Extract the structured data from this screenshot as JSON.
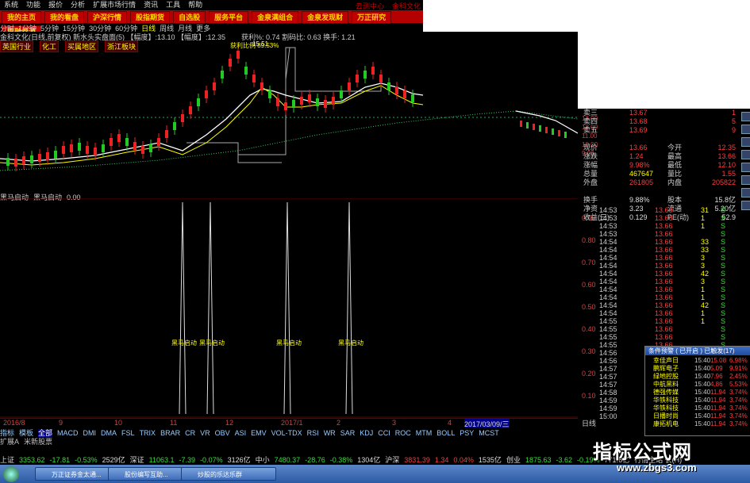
{
  "menu": [
    "系统",
    "功能",
    "报价",
    "分析",
    "扩展市场行情",
    "资讯",
    "工具",
    "帮助"
  ],
  "top_links": [
    "云测中心",
    "金科文化"
  ],
  "nav_tabs": [
    "我的主页",
    "我的看盘",
    "沪深行情",
    "股指期货",
    "自选股",
    "服务平台",
    "金泉满组合",
    "金泉发现财",
    "万正研究",
    "周融券源"
  ],
  "periods": [
    "分时",
    "1分钟",
    "5分钟",
    "15分钟",
    "30分钟",
    "60分钟",
    "日线",
    "周线",
    "月线",
    "更多"
  ],
  "info_line": "金科文化(日线,前复权) 新水头实盘面(5) 【幅度】:13.10 【幅度】:12.35",
  "info_right": "获利%: 0.74  割码比: 0.63  换手: 1.21",
  "tags": [
    "英国行业",
    "化工",
    "买属地区",
    "浙江板块"
  ],
  "chart_labels": {
    "max": "15.51",
    "profit": "获利比例 89.53%",
    "yellow_signals": [
      "金手指起",
      "金手指起",
      "金手指起"
    ]
  },
  "sub_indicator": {
    "name": "黑马启动",
    "field": "黑马启动",
    "value": "0.00"
  },
  "signal_label": "黑马启动",
  "signals_count": 4,
  "left_axis": [
    "0.90",
    "0.80",
    "0.70",
    "0.60",
    "0.50",
    "0.40",
    "0.30",
    "0.20",
    "0.10"
  ],
  "price_axis": [
    "13.00",
    "12.00",
    "11.00",
    "10.00",
    "9.00"
  ],
  "bottom_dates": [
    "2016/8",
    "9",
    "10",
    "11",
    "12",
    "2017/1",
    "2",
    "3",
    "4"
  ],
  "date_highlight": "2017/03/09/三",
  "indicator_tabs": [
    "指标",
    "模板",
    "全部",
    "MACD",
    "DMI",
    "DMA",
    "FSL",
    "TRIX",
    "BRAR",
    "CR",
    "VR",
    "OBV",
    "ASI",
    "EMV",
    "VOL-TDX",
    "RSI",
    "WR",
    "SAR",
    "KDJ",
    "CCI",
    "ROC",
    "MTM",
    "BOLL",
    "PSY",
    "MCST"
  ],
  "sheet_tabs": [
    "扩展A",
    "米新股票"
  ],
  "quote": {
    "rows": [
      {
        "l": "卖三",
        "m": "13.67",
        "mc": "up",
        "r": "",
        "rv": "1"
      },
      {
        "l": "卖四",
        "m": "13.68",
        "mc": "up",
        "r": "",
        "rv": "5"
      },
      {
        "l": "卖五",
        "m": "13.69",
        "mc": "up",
        "r": "",
        "rv": "9"
      },
      {
        "l": "",
        "m": "",
        "mc": "up",
        "r": "",
        "rv": ""
      },
      {
        "l": "现价",
        "m": "13.66",
        "mc": "up",
        "r": "今开",
        "rv": "12.35"
      },
      {
        "l": "涨跌",
        "m": "1.24",
        "mc": "up",
        "r": "最高",
        "rv": "13.66"
      },
      {
        "l": "涨幅",
        "m": "9.98%",
        "mc": "up",
        "r": "最低",
        "rv": "12.10"
      },
      {
        "l": "总量",
        "m": "467647",
        "mc": "yl",
        "r": "量比",
        "rv": "1.55"
      },
      {
        "l": "外盘",
        "m": "261805",
        "mc": "up",
        "r": "内盘",
        "rv": "205822"
      },
      {
        "l": "",
        "m": "",
        "mc": "up",
        "r": "",
        "rv": ""
      },
      {
        "l": "换手",
        "m": "9.88%",
        "mc": "wt",
        "r": "股本",
        "rv": "15.8亿"
      },
      {
        "l": "净资",
        "m": "3.23",
        "mc": "wt",
        "r": "流通",
        "rv": "5.20亿"
      },
      {
        "l": "收益(三)",
        "m": "0.129",
        "mc": "wt",
        "r": "PE(动)",
        "rv": "52.9"
      }
    ]
  },
  "ticks": [
    {
      "t": "14:53",
      "v": "31"
    },
    {
      "t": "14:53",
      "v": "1"
    },
    {
      "t": "14:53",
      "v": "1"
    },
    {
      "t": "14:53",
      "v": ""
    },
    {
      "t": "14:54",
      "v": "33"
    },
    {
      "t": "14:54",
      "v": "33"
    },
    {
      "t": "14:54",
      "v": "3"
    },
    {
      "t": "14:54",
      "v": "3"
    },
    {
      "t": "14:54",
      "v": "42"
    },
    {
      "t": "14:54",
      "v": "3"
    },
    {
      "t": "14:54",
      "v": "1"
    },
    {
      "t": "14:54",
      "v": "1"
    },
    {
      "t": "14:54",
      "v": "42"
    },
    {
      "t": "14:54",
      "v": "1"
    },
    {
      "t": "14:55",
      "v": "1"
    },
    {
      "t": "14:55",
      "v": ""
    },
    {
      "t": "14:55",
      "v": ""
    },
    {
      "t": "14:55",
      "v": ""
    },
    {
      "t": "14:56",
      "v": ""
    },
    {
      "t": "14:56",
      "v": ""
    },
    {
      "t": "14:57",
      "v": ""
    },
    {
      "t": "14:57",
      "v": ""
    },
    {
      "t": "14:57",
      "v": ""
    },
    {
      "t": "14:58",
      "v": ""
    },
    {
      "t": "14:59",
      "v": ""
    },
    {
      "t": "14:59",
      "v": ""
    },
    {
      "t": "15:00",
      "v": ""
    }
  ],
  "tick_price": "13.66",
  "tick_side": "S",
  "popup": {
    "title": "条件预警 ( 已开启 ) 已触发(17)",
    "rows": [
      {
        "n": "幸佳声日",
        "tm": "15:40",
        "px": "15.08",
        "pc": "6.98%"
      },
      {
        "n": "鹏辉电子",
        "tm": "15:40",
        "px": "5.09",
        "pc": "9.91%"
      },
      {
        "n": "绿地控股",
        "tm": "15:40",
        "px": "7.96",
        "pc": "2.45%"
      },
      {
        "n": "中航黑料",
        "tm": "15:40",
        "px": "4.86",
        "pc": "5.53%"
      },
      {
        "n": "德强传媒",
        "tm": "15:40",
        "px": "11.94",
        "pc": "3.74%"
      },
      {
        "n": "华铁科技",
        "tm": "15:40",
        "px": "11.94",
        "pc": "3.74%"
      },
      {
        "n": "华铁科技",
        "tm": "15:40",
        "px": "11.94",
        "pc": "3.74%"
      },
      {
        "n": "日播时尚",
        "tm": "15:40",
        "px": "11.94",
        "pc": "3.74%"
      },
      {
        "n": "康拓机电",
        "tm": "15:40",
        "px": "11.94",
        "pc": "3.74%"
      }
    ]
  },
  "status": [
    {
      "t": "上证",
      "c": "wt"
    },
    {
      "t": "3353.62",
      "c": "dn"
    },
    {
      "t": "-17.81",
      "c": "dn"
    },
    {
      "t": "-0.53%",
      "c": "dn"
    },
    {
      "t": "2529亿",
      "c": "wt"
    },
    {
      "t": "深证",
      "c": "wt"
    },
    {
      "t": "11063.1",
      "c": "dn"
    },
    {
      "t": "-7.39",
      "c": "dn"
    },
    {
      "t": "-0.07%",
      "c": "dn"
    },
    {
      "t": "3126亿",
      "c": "wt"
    },
    {
      "t": "中小",
      "c": "wt"
    },
    {
      "t": "7480.37",
      "c": "dn"
    },
    {
      "t": "-28.76",
      "c": "dn"
    },
    {
      "t": "-0.38%",
      "c": "dn"
    },
    {
      "t": "1304亿",
      "c": "wt"
    },
    {
      "t": "沪深",
      "c": "wt"
    },
    {
      "t": "3831.39",
      "c": "up"
    },
    {
      "t": "1.34",
      "c": "up"
    },
    {
      "t": "0.04%",
      "c": "up"
    },
    {
      "t": "1535亿",
      "c": "wt"
    },
    {
      "t": "创业",
      "c": "wt"
    },
    {
      "t": "1875.63",
      "c": "dn"
    },
    {
      "t": "-3.62",
      "c": "dn"
    },
    {
      "t": "-0.19%",
      "c": "dn"
    },
    {
      "t": "771.6亿",
      "c": "wt"
    },
    {
      "t": "行情主站 长(H)",
      "c": "wt"
    }
  ],
  "taskbar": [
    "万正证券金太通...",
    "股份编写互助...",
    "炒股的乐达乐群"
  ],
  "watermark": {
    "title": "指标公式网",
    "url": "www.zbgs3.com"
  },
  "side_label": "日线"
}
